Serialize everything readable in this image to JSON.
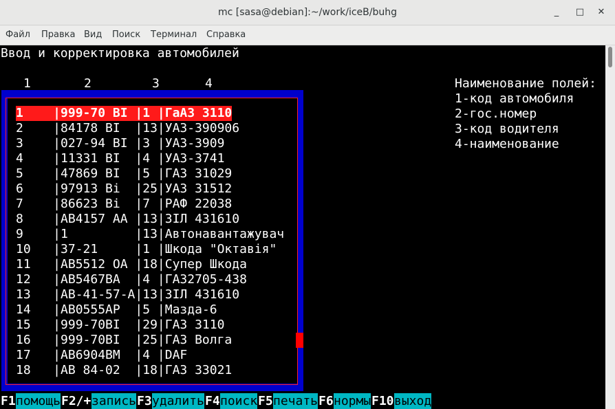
{
  "window": {
    "title": "mc [sasa@debian]:~/work/iceB/buhg",
    "minimize_glyph": "_",
    "maximize_glyph": "□",
    "close_glyph": "✕"
  },
  "menu": [
    "Файл",
    "Правка",
    "Вид",
    "Поиск",
    "Терминал",
    "Справка"
  ],
  "screen": {
    "heading": "Ввод и корректировка автомобилей",
    "column_numbers": [
      "1",
      "2",
      "3",
      "4"
    ],
    "legend": [
      "Наименование полей:",
      "1-код автомобиля",
      "2-гос.номер",
      "3-код водителя",
      "4-наименование"
    ]
  },
  "table": {
    "selected_index": 0,
    "rows": [
      "1    |999-70 BI |1 |ГаАЗ 3110",
      "2    |84178 BI  |13|УАЗ-390906",
      "3    |027-94 BI |3 |УАЗ-3909",
      "4    |11331 BI  |4 |УАЗ-3741",
      "5    |47869 BI  |5 |ГАЗ 31029",
      "6    |97913 Bi  |25|УАЗ 31512",
      "7    |86623 Bi  |7 |РАФ 22038",
      "8    |AB4157 AA |13|ЗIЛ 431610",
      "9    |1         |13|Автонавантажувач",
      "10   |37-21     |1 |Шкода \"Октавiя\"",
      "11   |AB5512 OA |18|Супер Шкода",
      "12   |AB5467BA  |4 |ГА32705-438",
      "13   |AB-41-57-A|13|ЗIЛ 431610",
      "14   |AB0555AP  |5 |Мазда-6",
      "15   |999-70BI  |29|ГАЗ 3110",
      "16   |999-70BI  |25|ГАЗ Волга",
      "17   |AB6904BM  |4 |DAF",
      "18   |AB 84-02  |18|ГАЗ 33021"
    ]
  },
  "function_keys": [
    {
      "key": "F1",
      "label": "помощь"
    },
    {
      "key": "F2/+",
      "label": "запись"
    },
    {
      "key": "F3",
      "label": "удалить"
    },
    {
      "key": "F4",
      "label": "поиск"
    },
    {
      "key": "F5",
      "label": "печать"
    },
    {
      "key": "F6",
      "label": "нормы"
    },
    {
      "key": "F10",
      "label": "выход"
    }
  ],
  "colors": {
    "panel_blue": "#0000cc",
    "selection_red": "#ff1a1a",
    "fkey_label_cyan": "#00b7c3"
  }
}
